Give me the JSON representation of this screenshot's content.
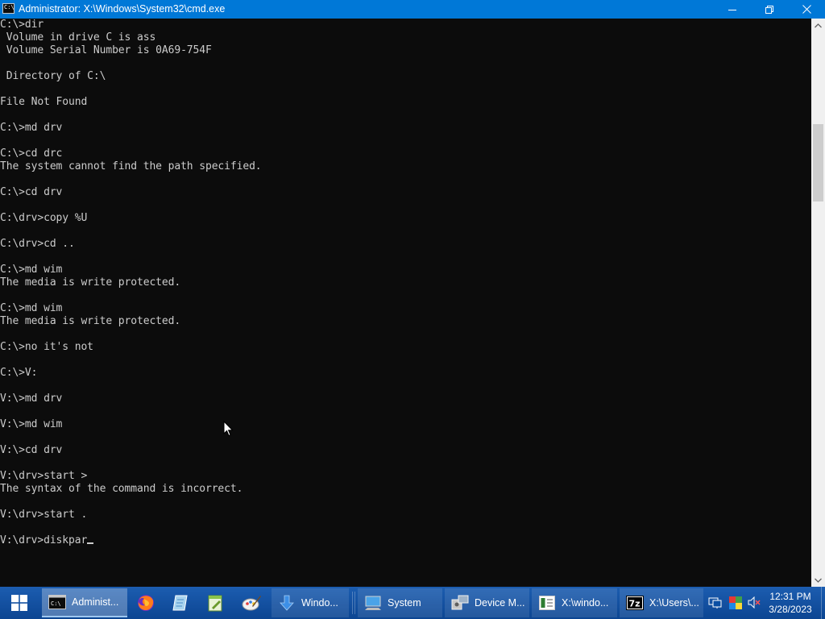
{
  "window": {
    "title": "Administrator: X:\\Windows\\System32\\cmd.exe",
    "app_icon_text": "C:\\",
    "buttons": {
      "minimize": "minimize-icon",
      "maximize": "restore-icon",
      "close": "close-icon"
    }
  },
  "console": {
    "lines": [
      "C:\\>dir",
      " Volume in drive C is ass",
      " Volume Serial Number is 0A69-754F",
      "",
      " Directory of C:\\",
      "",
      "File Not Found",
      "",
      "C:\\>md drv",
      "",
      "C:\\>cd drc",
      "The system cannot find the path specified.",
      "",
      "C:\\>cd drv",
      "",
      "C:\\drv>copy %U",
      "",
      "C:\\drv>cd ..",
      "",
      "C:\\>md wim",
      "The media is write protected.",
      "",
      "C:\\>md wim",
      "The media is write protected.",
      "",
      "C:\\>no it's not",
      "",
      "C:\\>V:",
      "",
      "V:\\>md drv",
      "",
      "V:\\>md wim",
      "",
      "V:\\>cd drv",
      "",
      "V:\\drv>start >",
      "The syntax of the command is incorrect.",
      "",
      "V:\\drv>start .",
      "",
      "V:\\drv>diskpar"
    ],
    "text_color": "#cccccc",
    "background": "#0c0c0c"
  },
  "taskbar": {
    "start": {
      "icon": "windows-logo-icon"
    },
    "pinned": [
      {
        "name": "firefox",
        "icon": "firefox-icon"
      },
      {
        "name": "paper",
        "icon": "paper-icon"
      },
      {
        "name": "notepad-plus",
        "icon": "notepad-plus-icon"
      },
      {
        "name": "paint",
        "icon": "paint-icon"
      }
    ],
    "tasks": [
      {
        "label": "Administ...",
        "icon": "cmd-icon",
        "active": true
      },
      {
        "label": "Windo...",
        "icon": "download-arrow-icon",
        "active": false
      },
      {
        "label": "System",
        "icon": "computer-icon",
        "active": false
      },
      {
        "label": "Device M...",
        "icon": "device-manager-icon",
        "active": false
      },
      {
        "label": "X:\\windo...",
        "icon": "window-icon",
        "active": false
      },
      {
        "label": "X:\\Users\\...",
        "icon": "7zip-icon",
        "active": false
      }
    ],
    "tray": [
      "network-icon",
      "color-icon",
      "volume-muted-icon"
    ],
    "clock": {
      "time": "12:31 PM",
      "date": "3/28/2023"
    },
    "accent": "#0a4fa4"
  },
  "scrollbar": {
    "up_icon": "scroll-up-icon",
    "down_icon": "scroll-down-icon"
  }
}
